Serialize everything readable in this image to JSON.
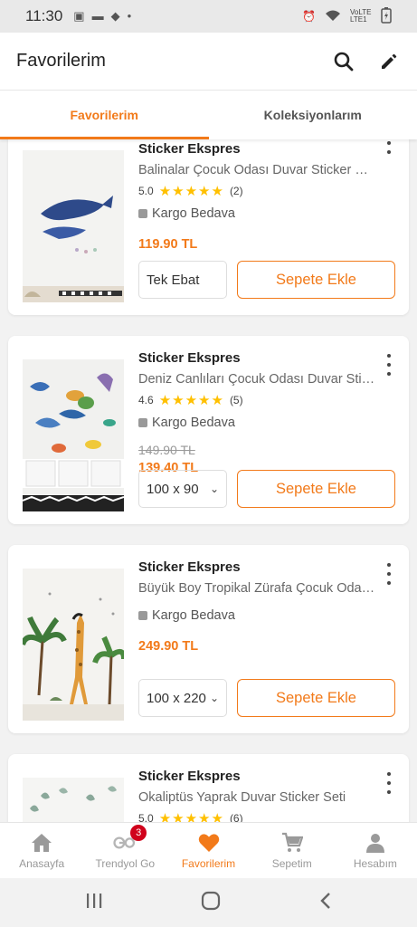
{
  "status": {
    "time": "11:30",
    "network": "VoLTE LTE1"
  },
  "header": {
    "title": "Favorilerim"
  },
  "tabs": [
    {
      "label": "Favorilerim",
      "active": true
    },
    {
      "label": "Koleksiyonlarım",
      "active": false
    }
  ],
  "products": [
    {
      "brand": "Sticker Ekspres",
      "name": "Balinalar Çocuk Odası Duvar Sticker Seti",
      "rating": "5.0",
      "stars": "★★★★★",
      "reviews": "(2)",
      "cargo": "Kargo Bedava",
      "old_price": "",
      "price": "119.90 TL",
      "variant": "Tek Ebat",
      "button": "Sepete Ekle"
    },
    {
      "brand": "Sticker Ekspres",
      "name": "Deniz Canlıları Çocuk Odası Duvar Stic...",
      "rating": "4.6",
      "stars": "★★★★★",
      "reviews": "(5)",
      "cargo": "Kargo Bedava",
      "old_price": "149.90 TL",
      "price": "139.40 TL",
      "variant": "100 x 90",
      "button": "Sepete Ekle"
    },
    {
      "brand": "Sticker Ekspres",
      "name": "Büyük Boy Tropikal Zürafa Çocuk Odas...",
      "cargo": "Kargo Bedava",
      "price": "249.90 TL",
      "variant": "100 x 220",
      "button": "Sepete Ekle"
    },
    {
      "brand": "Sticker Ekspres",
      "name": "Okaliptüs Yaprak Duvar Sticker Seti",
      "rating": "5.0",
      "stars": "★★★★★",
      "reviews": "(6)"
    }
  ],
  "nav": [
    {
      "label": "Anasayfa",
      "icon": "home-icon"
    },
    {
      "label": "Trendyol Go",
      "icon": "trendyol-go-icon",
      "badge": "3"
    },
    {
      "label": "Favorilerim",
      "icon": "heart-icon",
      "active": true
    },
    {
      "label": "Sepetim",
      "icon": "cart-icon"
    },
    {
      "label": "Hesabım",
      "icon": "person-icon"
    }
  ],
  "colors": {
    "accent": "#f27a1a",
    "star": "#ffc000",
    "badge": "#d0021b"
  }
}
